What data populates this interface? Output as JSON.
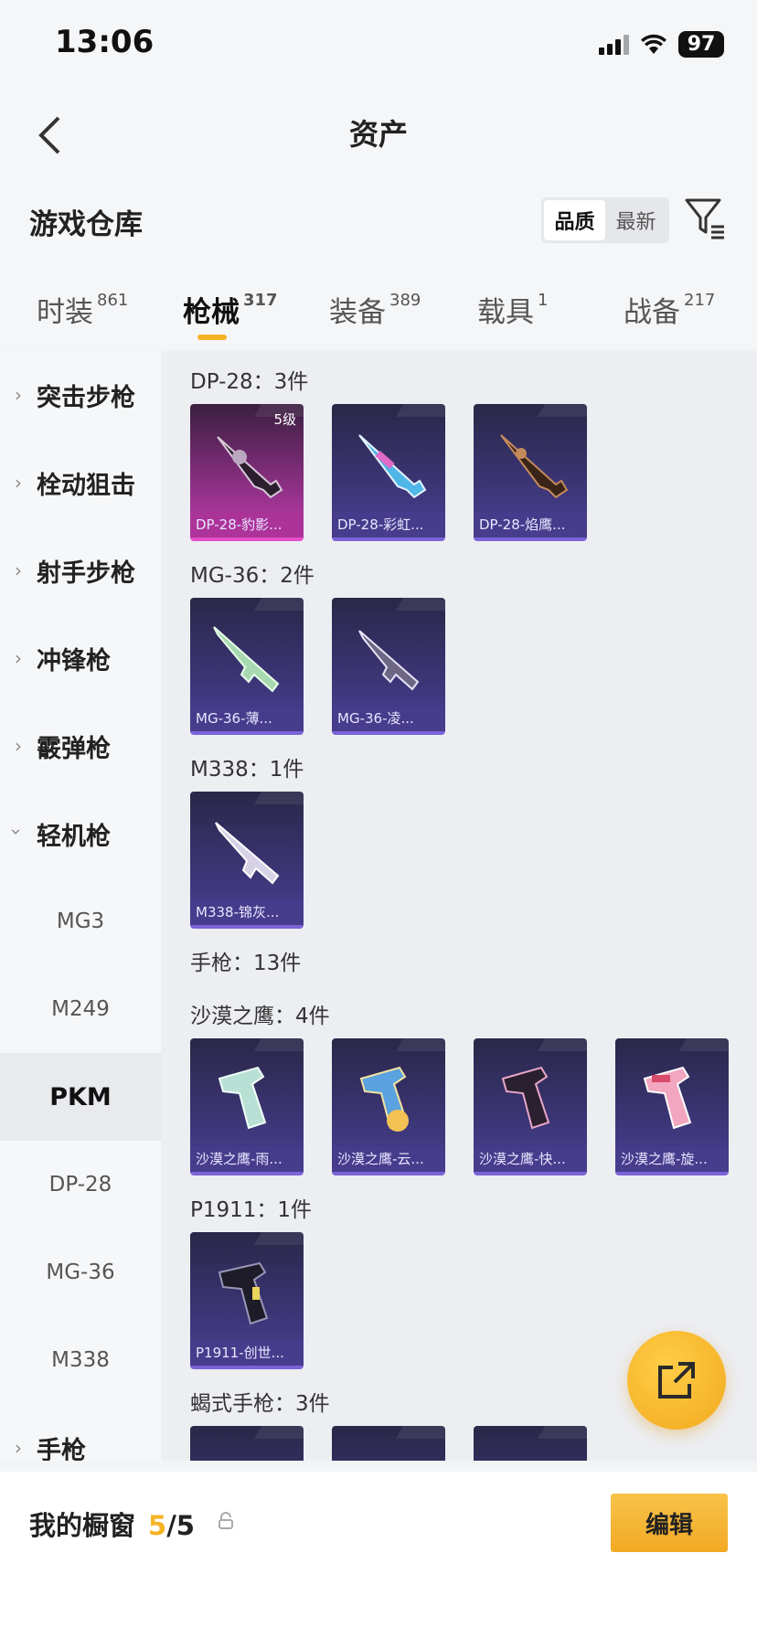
{
  "status": {
    "time": "13:06",
    "battery": "97"
  },
  "nav": {
    "title": "资产"
  },
  "warehouse": {
    "title": "游戏仓库",
    "sort_quality": "品质",
    "sort_newest": "最新"
  },
  "tabs": [
    {
      "label": "时装",
      "count": "861"
    },
    {
      "label": "枪械",
      "count": "317"
    },
    {
      "label": "装备",
      "count": "389"
    },
    {
      "label": "载具",
      "count": "1"
    },
    {
      "label": "战备",
      "count": "217"
    }
  ],
  "sidebar": {
    "categories": [
      "突击步枪",
      "栓动狙击",
      "射手步枪",
      "冲锋枪",
      "霰弹枪",
      "轻机枪",
      "手枪"
    ],
    "subitems": [
      "MG3",
      "M249",
      "PKM",
      "DP-28",
      "MG-36",
      "M338"
    ]
  },
  "groups": {
    "dp28": {
      "title": "DP-28：3件",
      "items": [
        "DP-28-豹影...",
        "DP-28-彩虹...",
        "DP-28-焰鹰..."
      ],
      "level": "5级"
    },
    "mg36": {
      "title": "MG-36：2件",
      "items": [
        "MG-36-薄...",
        "MG-36-凌..."
      ]
    },
    "m338": {
      "title": "M338：1件",
      "items": [
        "M338-锦灰..."
      ]
    },
    "pistol": {
      "title": "手枪：13件"
    },
    "deagle": {
      "title": "沙漠之鹰：4件",
      "items": [
        "沙漠之鹰-雨...",
        "沙漠之鹰-云...",
        "沙漠之鹰-快...",
        "沙漠之鹰-旋..."
      ]
    },
    "p1911": {
      "title": "P1911：1件",
      "items": [
        "P1911-创世..."
      ]
    },
    "scorpion": {
      "title": "蝎式手枪：3件"
    }
  },
  "showcase": {
    "label": "我的橱窗",
    "current": "5",
    "separator": "/",
    "total": "5",
    "edit": "编辑"
  },
  "colors": {
    "accent": "#f5b324",
    "card": "#3b3575",
    "card_pink": "#c13cb0"
  }
}
